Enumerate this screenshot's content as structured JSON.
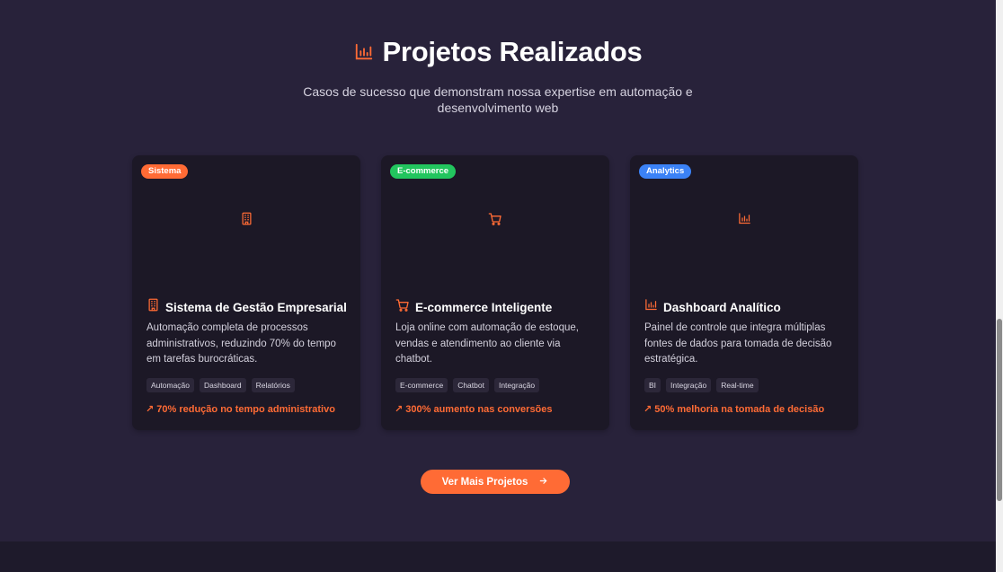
{
  "header": {
    "icon": "bar-chart-icon",
    "title": "Projetos Realizados",
    "subtitle": "Casos de sucesso que demonstram nossa expertise em automação e desenvolvimento web"
  },
  "colors": {
    "accent": "#ff6b35",
    "background": "#28223a",
    "card": "#1c1826"
  },
  "projects": [
    {
      "badge": "Sistema",
      "badge_color": "#ff6b35",
      "icon": "building-icon",
      "title": "Sistema de Gestão Empresarial",
      "description": "Automação completa de processos administrativos, reduzindo 70% do tempo em tarefas burocráticas.",
      "tags": [
        "Automação",
        "Dashboard",
        "Relatórios"
      ],
      "result": "↗ 70% redução no tempo administrativo"
    },
    {
      "badge": "E-commerce",
      "badge_color": "#22c55e",
      "icon": "shopping-cart-icon",
      "title": "E-commerce Inteligente",
      "description": "Loja online com automação de estoque, vendas e atendimento ao cliente via chatbot.",
      "tags": [
        "E-commerce",
        "Chatbot",
        "Integração"
      ],
      "result": "↗ 300% aumento nas conversões"
    },
    {
      "badge": "Analytics",
      "badge_color": "#3b82f6",
      "icon": "bar-chart-icon",
      "title": "Dashboard Analítico",
      "description": "Painel de controle que integra múltiplas fontes de dados para tomada de decisão estratégica.",
      "tags": [
        "BI",
        "Integração",
        "Real-time"
      ],
      "result": "↗ 50% melhoria na tomada de decisão"
    }
  ],
  "cta": {
    "label": "Ver Mais Projetos",
    "icon": "arrow-right-icon"
  }
}
